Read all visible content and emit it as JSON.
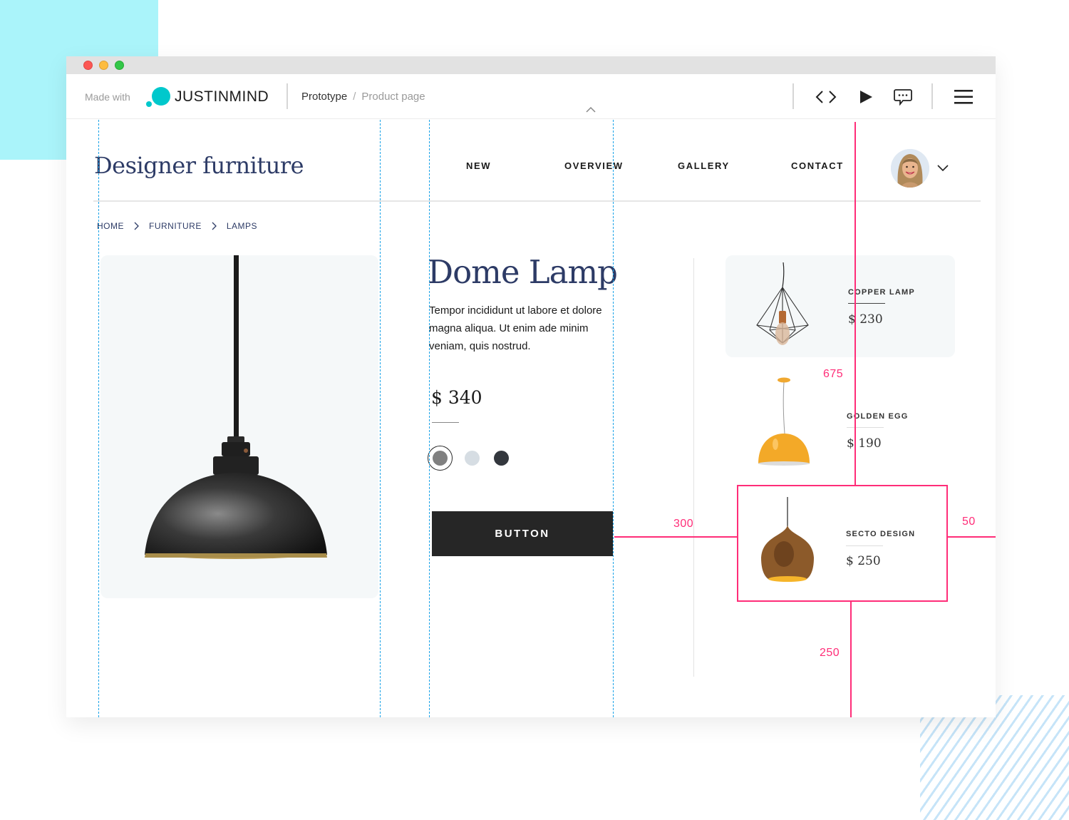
{
  "jim_bar": {
    "made_with": "Made with",
    "brand_name": "JUSTINMIND",
    "breadcrumb_root": "Prototype",
    "breadcrumb_separator": "/",
    "breadcrumb_page": "Product page",
    "icons": [
      "code-icon",
      "play-icon",
      "comment-icon",
      "menu-icon"
    ]
  },
  "site": {
    "brand": "Designer furniture",
    "nav": [
      "NEW",
      "OVERVIEW",
      "GALLERY",
      "CONTACT"
    ]
  },
  "breadcrumb": [
    "HOME",
    "FURNITURE",
    "LAMPS"
  ],
  "product": {
    "title": "Dome Lamp",
    "description": "Tempor incididunt ut labore et dolore magna aliqua. Ut enim ade minim veniam, quis nostrud.",
    "price": "$ 340",
    "swatches": [
      {
        "name": "gray",
        "color": "#808080",
        "selected": true
      },
      {
        "name": "light-gray",
        "color": "#d6dde3",
        "selected": false
      },
      {
        "name": "charcoal",
        "color": "#33373d",
        "selected": false
      }
    ],
    "button_label": "BUTTON"
  },
  "related": [
    {
      "name": "COPPER LAMP",
      "price": "$ 230"
    },
    {
      "name": "GOLDEN EGG",
      "price": "$ 190"
    },
    {
      "name": "SECTO DESIGN",
      "price": "$ 250"
    }
  ],
  "measurements": {
    "top": "675",
    "left": "300",
    "right": "50",
    "bottom": "250"
  },
  "colors": {
    "accent_cyan": "#00c8cc",
    "heading_navy": "#2d3b66",
    "guide_blue": "#1aa3e8",
    "measure_pink": "#ff2d78",
    "button_dark": "#262626"
  }
}
